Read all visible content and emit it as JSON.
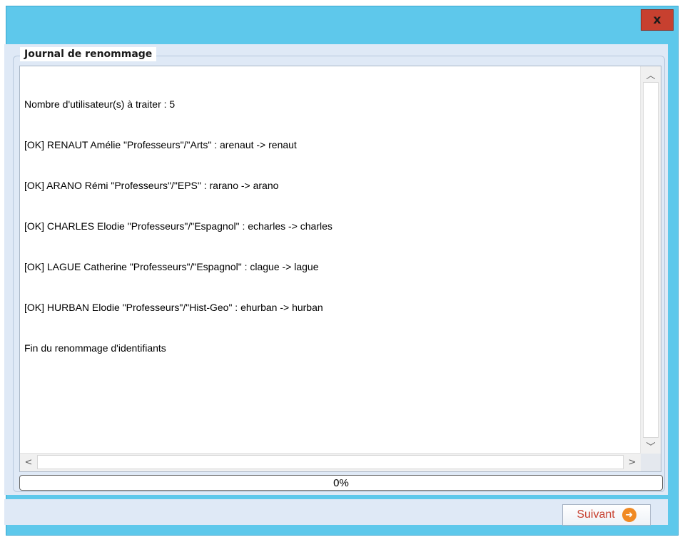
{
  "window": {
    "close_label": "x"
  },
  "journal": {
    "title": "Journal de renommage",
    "lines": [
      "Nombre d'utilisateur(s) à traiter : 5",
      "[OK] RENAUT Amélie \"Professeurs\"/\"Arts\" : arenaut -> renaut",
      "[OK] ARANO Rémi \"Professeurs\"/\"EPS\" : rarano -> arano",
      "[OK] CHARLES Elodie \"Professeurs\"/\"Espagnol\" : echarles -> charles",
      "[OK] LAGUE Catherine \"Professeurs\"/\"Espagnol\" : clague -> lague",
      "[OK] HURBAN Elodie \"Professeurs\"/\"Hist-Geo\" : ehurban -> hurban",
      "Fin du renommage d'identifiants"
    ]
  },
  "progress": {
    "label": "0%",
    "fraction": 0
  },
  "footer": {
    "next_label": "Suivant"
  },
  "icons": {
    "close": "close-icon",
    "next": "arrow-right-circle-icon"
  },
  "colors": {
    "window_bg": "#5ec8eb",
    "client_bg": "#dfe9f6",
    "close_bg": "#c7402f",
    "accent_text": "#c7402f",
    "next_icon": "#f08a24"
  }
}
